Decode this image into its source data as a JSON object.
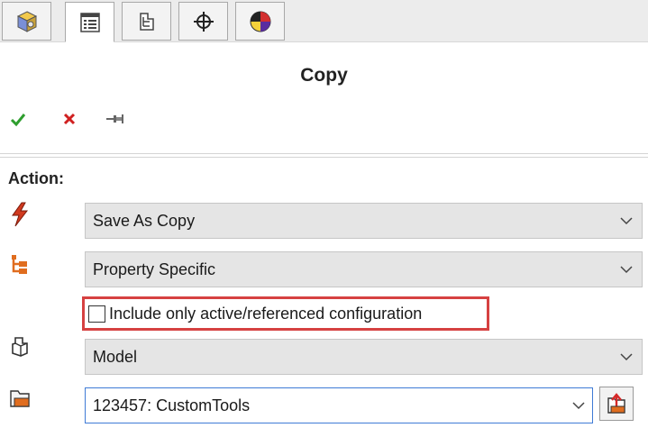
{
  "tabs": [
    {
      "name": "feature-manager",
      "icon": "assembly-cube-icon",
      "active": false
    },
    {
      "name": "property-manager",
      "icon": "property-manager-icon",
      "active": true
    },
    {
      "name": "configuration-manager",
      "icon": "configuration-manager-icon",
      "active": false
    },
    {
      "name": "dimxpert-manager",
      "icon": "crosshair-icon",
      "active": false
    },
    {
      "name": "display-manager",
      "icon": "appearance-pie-icon",
      "active": false
    }
  ],
  "panel": {
    "title": "Copy",
    "toolbar": {
      "ok": "check-icon",
      "cancel": "x-icon",
      "pin": "pushpin-icon"
    }
  },
  "action": {
    "label": "Action:",
    "rows": [
      {
        "icon": "lightning-icon",
        "value": "Save As Copy"
      },
      {
        "icon": "property-tree-icon",
        "value": "Property Specific"
      }
    ],
    "checkbox": {
      "label": "Include only active/referenced configuration",
      "checked": false
    },
    "model_row": {
      "icon": "model-configuration-icon",
      "value": "Model"
    },
    "folder_row": {
      "icon": "vault-folder-icon",
      "value": "123457: CustomTools",
      "browse_icon": "browse-folder-icon"
    }
  },
  "colors": {
    "accent": "#3f7bd6",
    "highlight": "#d64141",
    "ok": "#2e9e2e",
    "cancel": "#d02020"
  }
}
